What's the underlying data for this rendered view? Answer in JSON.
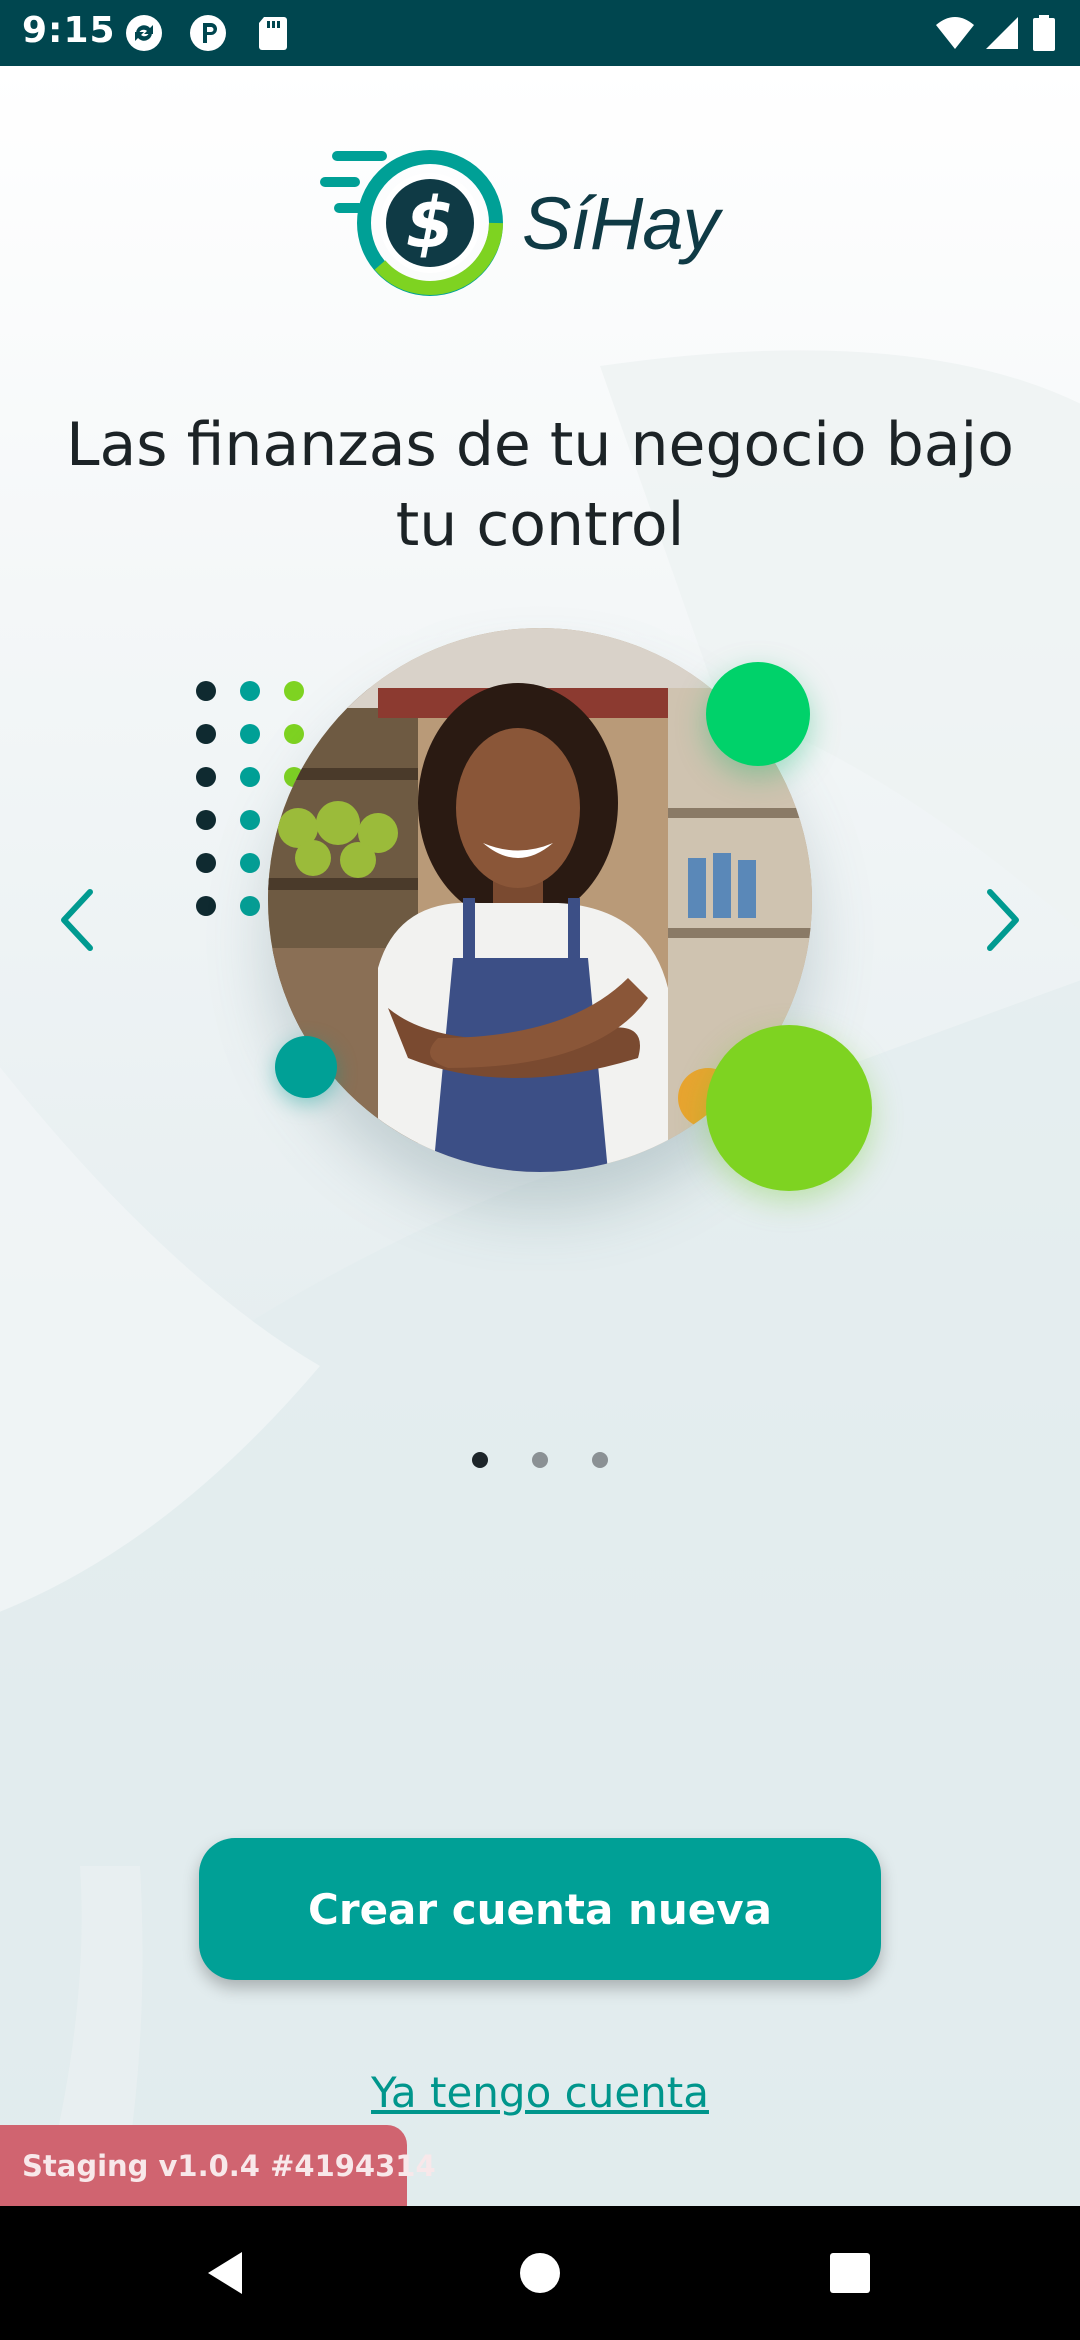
{
  "status_bar": {
    "time": "9:15",
    "icons": [
      "sync-icon",
      "p-icon",
      "sd-card-icon",
      "wifi-icon",
      "signal-icon",
      "battery-icon"
    ]
  },
  "brand": {
    "name": "SíHay",
    "primary_color": "#00a096",
    "accent_green": "#7ed321",
    "dark_color": "#0f3a45"
  },
  "headline": "Las finanzas de tu negocio bajo tu control",
  "carousel": {
    "prev_icon": "chevron-left-icon",
    "next_icon": "chevron-right-icon",
    "page_count": 3,
    "active_page": 1
  },
  "actions": {
    "create_account": "Crear cuenta nueva",
    "have_account": "Ya tengo cuenta"
  },
  "staging_label": "Staging v1.0.4 #4194314",
  "nav_bar": {
    "icons": [
      "back-icon",
      "home-icon",
      "recents-icon"
    ]
  }
}
